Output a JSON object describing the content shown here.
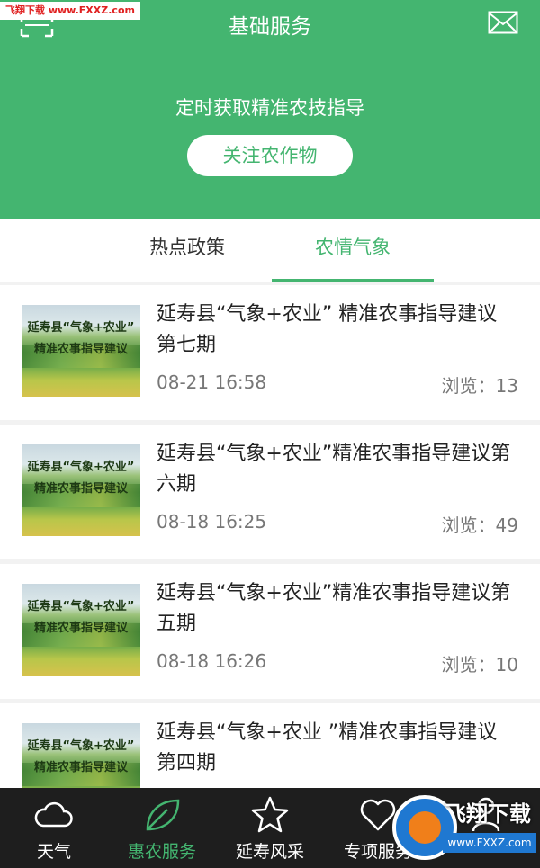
{
  "watermark": "飞翔下载 www.FXXZ.com",
  "header": {
    "title": "基础服务",
    "scan_icon": "scan-icon",
    "mail_icon": "mail-icon"
  },
  "banner": {
    "text": "定时获取精准农技指导",
    "button_label": "关注农作物"
  },
  "tabs": [
    {
      "label": "热点政策",
      "active": false
    },
    {
      "label": "农情气象",
      "active": true
    }
  ],
  "thumbnail": {
    "line1": "延寿县“气象+农业”",
    "line2": "精准农事指导建议"
  },
  "articles": [
    {
      "title": "延寿县“气象+农业” 精准农事指导建议第七期",
      "date": "08-21 16:58",
      "views_label": "浏览：",
      "views": "13"
    },
    {
      "title": "延寿县“气象+农业”精准农事指导建议第六期",
      "date": "08-18 16:25",
      "views_label": "浏览：",
      "views": "49"
    },
    {
      "title": "延寿县“气象+农业”精准农事指导建议第五期",
      "date": "08-18 16:26",
      "views_label": "浏览：",
      "views": "10"
    },
    {
      "title": "延寿县“气象+农业 ”精准农事指导建议第四期",
      "date": "",
      "views_label": "",
      "views": ""
    }
  ],
  "nav": [
    {
      "label": "天气",
      "icon": "cloud-icon",
      "active": false
    },
    {
      "label": "惠农服务",
      "icon": "leaf-icon",
      "active": true
    },
    {
      "label": "延寿风采",
      "icon": "star-icon",
      "active": false
    },
    {
      "label": "专项服务",
      "icon": "heart-icon",
      "active": false
    },
    {
      "label": "",
      "icon": "person-icon",
      "active": false
    }
  ],
  "badge": {
    "text": "飞翔下载",
    "url": "www.FXXZ.com"
  },
  "colors": {
    "brand_green": "#44b570",
    "nav_bg": "#1e1e1e"
  }
}
